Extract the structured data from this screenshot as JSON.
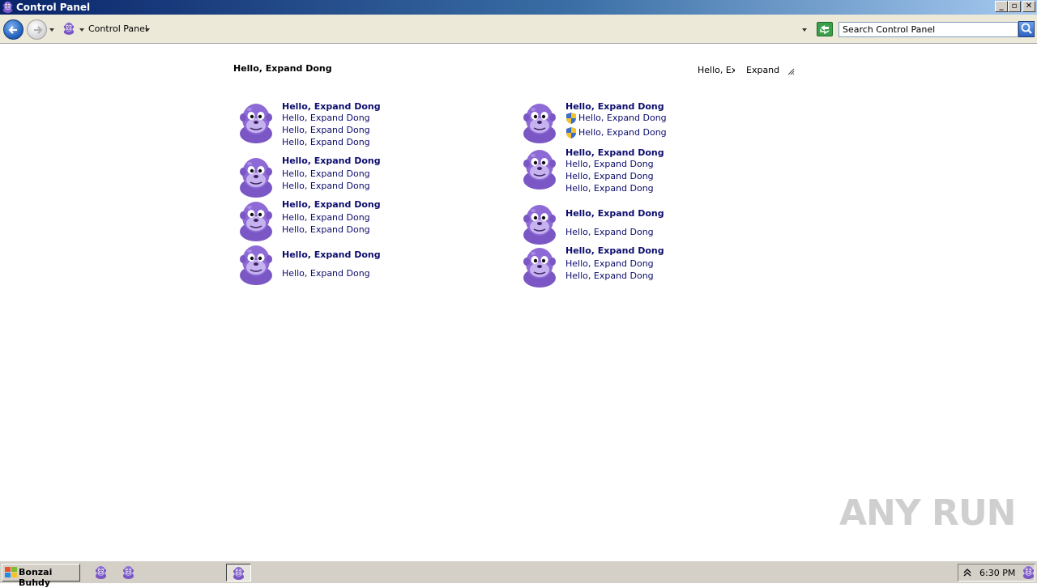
{
  "window": {
    "title": "Control Panel"
  },
  "address": {
    "location": "Control Panel"
  },
  "search": {
    "placeholder": "Search Control Panel"
  },
  "header": {
    "title": "Hello, Expand Dong",
    "view_label": "Hello, Ex",
    "view_value": "Expand I"
  },
  "categories": [
    {
      "title": "Hello, Expand Dong",
      "links": [
        "Hello, Expand Dong",
        "Hello, Expand Dong",
        "Hello, Expand Dong"
      ]
    },
    {
      "title": "Hello, Expand Dong",
      "links": [
        "Hello, Expand Dong",
        "Hello, Expand Dong"
      ]
    },
    {
      "title": "Hello, Expand Dong",
      "links": [
        "Hello, Expand Dong",
        "Hello, Expand Dong"
      ]
    },
    {
      "title": "Hello, Expand Dong",
      "links": [
        "Hello, Expand Dong"
      ]
    },
    {
      "title": "Hello, Expand Dong",
      "links": [
        "Hello, Expand Dong",
        "Hello, Expand Dong"
      ]
    },
    {
      "title": "Hello, Expand Dong",
      "links": [
        "Hello, Expand Dong",
        "Hello, Expand Dong",
        "Hello, Expand Dong"
      ]
    },
    {
      "title": "Hello, Expand Dong",
      "links": [
        "Hello, Expand Dong"
      ]
    },
    {
      "title": "Hello, Expand Dong",
      "links": [
        "Hello, Expand Dong",
        "Hello, Expand Dong"
      ]
    }
  ],
  "icons": {
    "category": "bonzi-buddy-icon",
    "admin": "uac-shield-icon"
  },
  "watermark": "ANY RUN",
  "taskbar": {
    "start_label": "Bonzai Buhdy",
    "clock": "6:30 PM"
  },
  "colors": {
    "link": "#0c0c6e",
    "titlebar_start": "#0a246a",
    "titlebar_end": "#a6caf0",
    "bonzi_purple": "#8a6ad0"
  }
}
